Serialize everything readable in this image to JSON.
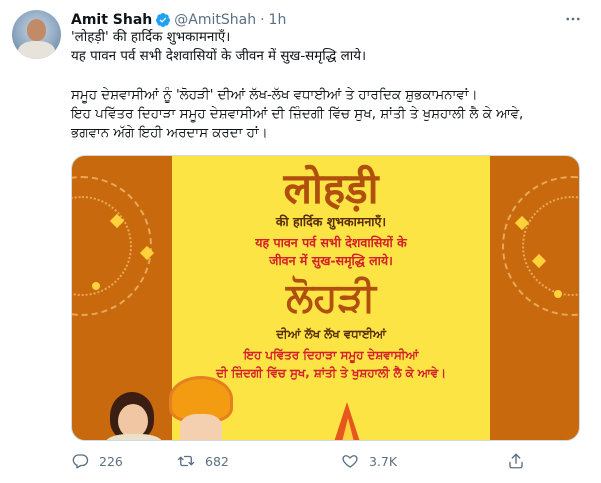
{
  "tweet": {
    "author_name": "Amit Shah",
    "handle": "@AmitShah",
    "separator": "·",
    "time": "1h",
    "lines": [
      "'लोहड़ी' की हार्दिक शुभकामनाएँ।",
      "यह पावन पर्व सभी देशवासियों के जीवन में सुख-समृद्धि लाये।",
      "ਸਮੂਹ ਦੇਸ਼ਵਾਸੀਆਂ ਨੂੰ 'ਲੋਹੜੀ' ਦੀਆਂ ਲੱਖ-ਲੱਖ ਵਧਾਈਆਂ ਤੇ ਹਾਰਦਿਕ ਸ਼ੁਭਕਾਮਨਾਵਾਂ।",
      "ਇਹ ਪਵਿੱਤਰ ਦਿਹਾੜਾ ਸਮੂਹ ਦੇਸ਼ਵਾਸੀਆਂ ਦੀ ਜ਼ਿੰਦਗੀ ਵਿੱਚ ਸੁਖ, ਸ਼ਾਂਤੀ ਤੇ ਖੁਸ਼ਹਾਲੀ ਲੈ ਕੇ ਆਵੇ,",
      "ਭਗਵਾਨ ਅੱਗੇ ਇਹੀ ਅਰਦਾਸ ਕਰਦਾ ਹਾਂ।"
    ]
  },
  "card": {
    "title_hindi": "लोहड़ी",
    "subtitle_hindi": "की हार्दिक शुभकामनाएँ।",
    "message_hindi_1": "यह पावन पर्व सभी देशवासियों के",
    "message_hindi_2": "जीवन में सुख-समृद्धि लाये।",
    "title_punjabi": "ਲੋਹੜੀ",
    "subtitle_punjabi": "ਦੀਆਂ ਲੱਖ ਲੱਖ ਵਧਾਈਆਂ",
    "message_punjabi_1": "ਇਹ ਪਵਿੱਤਰ ਦਿਹਾੜਾ ਸਮੂਹ ਦੇਸ਼ਵਾਸੀਆਂ",
    "message_punjabi_2": "ਦੀ ਜ਼ਿੰਦਗੀ ਵਿੱਚ ਸੁਖ, ਸ਼ਾਂਤੀ ਤੇ ਖੁਸ਼ਹਾਲੀ ਲੈ ਕੇ ਆਵੇ।",
    "colors": {
      "background": "#c9690d",
      "panel": "#fbe443",
      "title": "#b04f0e",
      "accent": "#d5202b"
    }
  },
  "actions": {
    "reply_count": "226",
    "retweet_count": "682",
    "like_count": "3.7K"
  },
  "icons": {
    "verified": "verified-badge-icon",
    "more": "more-icon",
    "reply": "reply-icon",
    "retweet": "retweet-icon",
    "like": "heart-icon",
    "share": "share-icon"
  },
  "colors": {
    "verified": "#1da1f2",
    "secondary_text": "#5b7083"
  }
}
